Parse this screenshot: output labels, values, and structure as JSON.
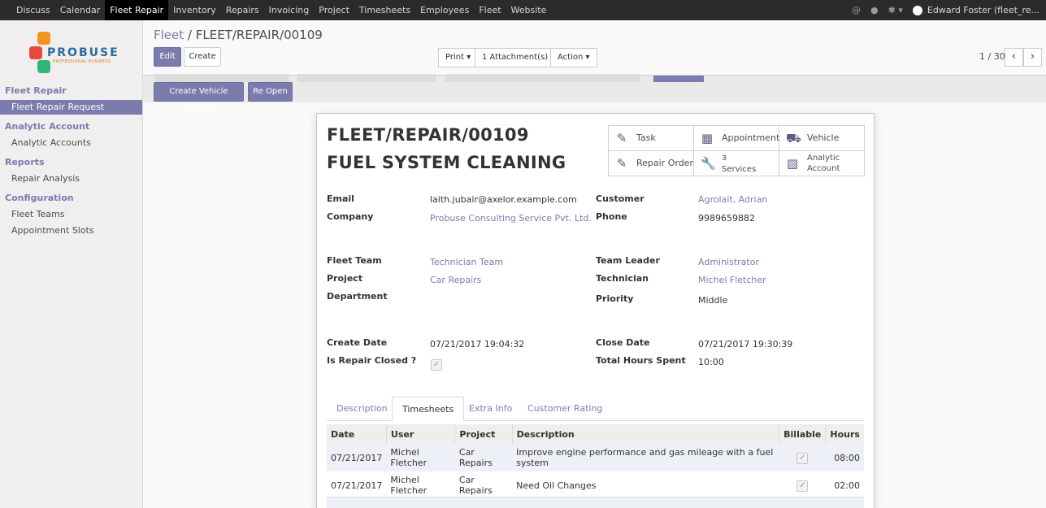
{
  "topbar": {
    "menu": [
      "Discuss",
      "Calendar",
      "Fleet Repair",
      "Inventory",
      "Repairs",
      "Invoicing",
      "Project",
      "Timesheets",
      "Employees",
      "Fleet",
      "Website"
    ],
    "active_menu": "Fleet Repair",
    "username": "Edward Foster (fleet_re..."
  },
  "sidebar": {
    "logo_text": "PROBUSE",
    "logo_tagline": "PROFESSIONAL BUSINESS",
    "sections": [
      {
        "title": "Fleet Repair",
        "items": [
          "Fleet Repair Request"
        ]
      },
      {
        "title": "Analytic Account",
        "items": [
          "Analytic Accounts"
        ]
      },
      {
        "title": "Reports",
        "items": [
          "Repair Analysis"
        ]
      },
      {
        "title": "Configuration",
        "items": [
          "Fleet Teams",
          "Appointment Slots"
        ]
      }
    ]
  },
  "breadcrumb": {
    "parent": "Fleet",
    "separator": "/",
    "current": "FLEET/REPAIR/00109"
  },
  "buttons": {
    "edit": "Edit",
    "create": "Create",
    "print": "Print",
    "attachments": "1 Attachment(s)",
    "action": "Action",
    "create_vehicle_service": "Create Vehicle Service",
    "reopen": "Re Open"
  },
  "pager": {
    "value": "1 / 30"
  },
  "sheet": {
    "title_line1": "FLEET/REPAIR/00109",
    "title_line2": "FUEL SYSTEM CLEANING",
    "smart_buttons": {
      "task": "Task",
      "appointment": "Appointment",
      "vehicle": "Vehicle",
      "repair_order": "Repair Order",
      "services_count": "3",
      "services_label": "Services",
      "analytic_line1": "Analytic",
      "analytic_line2": "Account"
    },
    "fields": {
      "email_label": "Email",
      "email": "laith.jubair@axelor.example.com",
      "company_label": "Company",
      "company": "Probuse Consulting Service Pvt. Ltd.",
      "customer_label": "Customer",
      "customer": "Agrolait, Adrian",
      "phone_label": "Phone",
      "phone": "9989659882",
      "fleet_team_label": "Fleet Team",
      "fleet_team": "Technician Team",
      "project_label": "Project",
      "project": "Car Repairs",
      "department_label": "Department",
      "team_leader_label": "Team Leader",
      "team_leader": "Administrator",
      "technician_label": "Technician",
      "technician": "Michel Fletcher",
      "priority_label": "Priority",
      "priority": "Middle",
      "create_date_label": "Create Date",
      "create_date": "07/21/2017 19:04:32",
      "is_repair_closed_label": "Is Repair Closed ?",
      "close_date_label": "Close Date",
      "close_date": "07/21/2017 19:30:39",
      "total_hours_label": "Total Hours Spent",
      "total_hours": "10:00"
    },
    "tabs": [
      "Description",
      "Timesheets",
      "Extra Info",
      "Customer Rating"
    ],
    "active_tab": "Timesheets",
    "timesheet": {
      "columns": [
        "Date",
        "User",
        "Project",
        "Description",
        "Billable",
        "Hours"
      ],
      "rows": [
        {
          "date": "07/21/2017",
          "user": "Michel Fletcher",
          "project": "Car Repairs",
          "description": "Improve engine performance and gas mileage with a fuel system",
          "billable": true,
          "hours": "08:00"
        },
        {
          "date": "07/21/2017",
          "user": "Michel Fletcher",
          "project": "Car Repairs",
          "description": "Need Oil Changes",
          "billable": true,
          "hours": "02:00"
        }
      ]
    }
  },
  "colors": {
    "accent": "#7c7bad",
    "topbar": "#2b2b2b",
    "sidebar": "#f0eeee"
  }
}
